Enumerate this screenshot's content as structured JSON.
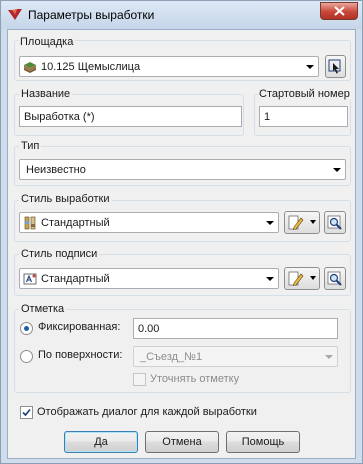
{
  "window": {
    "title": "Параметры выработки"
  },
  "site": {
    "group_label": "Площадка",
    "value": "10.125 Щемыслица",
    "icon": "terrain-layers-icon",
    "pick_button_icon": "select-from-drawing-icon"
  },
  "name": {
    "label": "Название",
    "value": "Выработка (*)"
  },
  "start_number": {
    "label": "Стартовый номер",
    "value": "1"
  },
  "type": {
    "group_label": "Тип",
    "value": "Неизвестно"
  },
  "style": {
    "group_label": "Стиль выработки",
    "value": "Стандартный",
    "icon": "borehole-style-icon",
    "edit_icon": "pencil-edit-icon",
    "preview_icon": "magnifier-preview-icon"
  },
  "label_style": {
    "group_label": "Стиль подписи",
    "value": "Стандартный",
    "icon": "label-style-icon",
    "edit_icon": "pencil-edit-icon",
    "preview_icon": "magnifier-preview-icon"
  },
  "elevation": {
    "group_label": "Отметка",
    "fixed_label": "Фиксированная:",
    "fixed_value": "0.00",
    "surface_label": "По поверхности:",
    "surface_value": "_Съезд_№1",
    "refine_label": "Уточнять отметку"
  },
  "show_dialog": {
    "label": "Отображать диалог для каждой выработки"
  },
  "buttons": {
    "ok": "Да",
    "cancel": "Отмена",
    "help": "Помощь"
  },
  "colors": {
    "title_bg": "#c6d6e9",
    "client_bg": "#f0f0f0",
    "close_red": "#c8473a",
    "accent_blue": "#1b5fa8"
  }
}
